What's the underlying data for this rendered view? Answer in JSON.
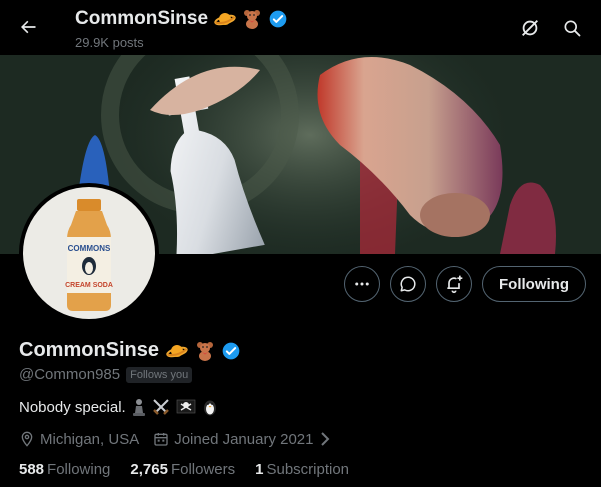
{
  "header": {
    "name": "CommonSinse",
    "posts_count": "29.9K posts"
  },
  "profile": {
    "name": "CommonSinse",
    "handle": "@Common985",
    "follows_you": "Follows you",
    "bio": "Nobody special.",
    "location": "Michigan, USA",
    "joined": "Joined January 2021",
    "verified_color": "#1d9bf0"
  },
  "actions": {
    "following_label": "Following"
  },
  "stats": {
    "following_count": "588",
    "following_label": "Following",
    "followers_count": "2,765",
    "followers_label": "Followers",
    "subscription_count": "1",
    "subscription_label": "Subscription"
  },
  "avatar": {
    "label_top": "COMMONS",
    "label_bottom": "CREAM SODA"
  }
}
